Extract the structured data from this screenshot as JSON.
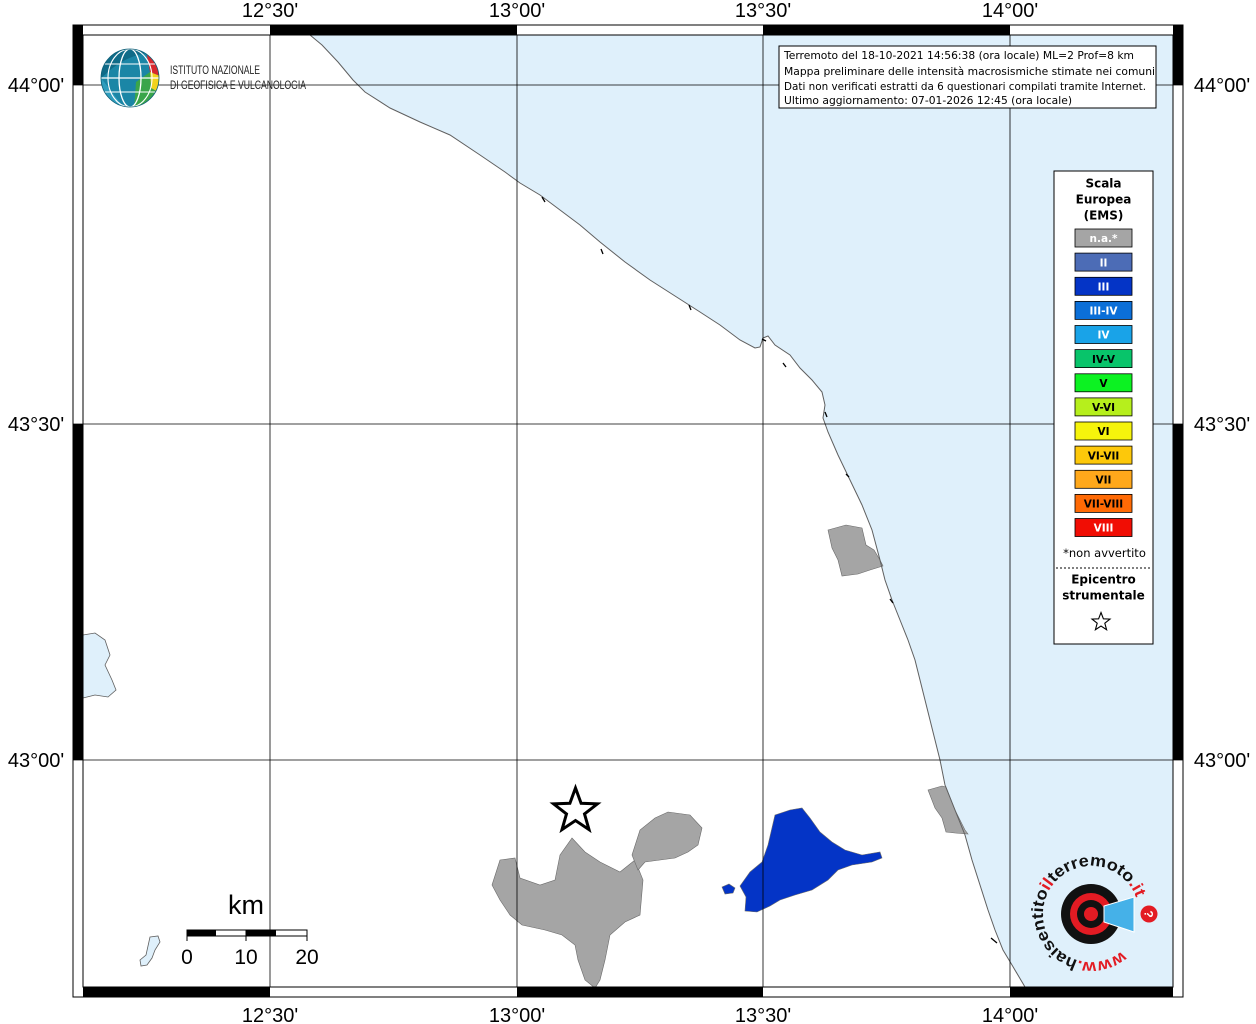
{
  "axes": {
    "lon_labels": [
      "12°30'",
      "13°00'",
      "13°30'",
      "14°00'"
    ],
    "lat_labels": [
      "44°00'",
      "43°30'",
      "43°00'"
    ]
  },
  "institute_logo": {
    "line1": "ISTITUTO NAZIONALE",
    "line2": "DI GEOFISICA E VULCANOLOGIA",
    "icon": "globe-icon"
  },
  "info_box": {
    "lines": [
      "Terremoto del 18-10-2021 14:56:38 (ora locale) ML=2 Prof=8 km",
      "Mappa preliminare delle intensità macrosismiche stimate nei comuni",
      "Dati non verificati estratti da 6 questionari compilati tramite Internet.",
      "Ultimo aggiornamento: 07-01-2026 12:45 (ora locale)"
    ]
  },
  "legend": {
    "title": [
      "Scala",
      "Europea",
      "(EMS)"
    ],
    "entries": [
      {
        "label": "n.a.*",
        "color": "#a5a5a5",
        "text_color": "#ffffff"
      },
      {
        "label": "II",
        "color": "#4c6cb6",
        "text_color": "#ffffff"
      },
      {
        "label": "III",
        "color": "#0434c6",
        "text_color": "#ffffff"
      },
      {
        "label": "III-IV",
        "color": "#0b6fd8",
        "text_color": "#ffffff"
      },
      {
        "label": "IV",
        "color": "#19a3e8",
        "text_color": "#ffffff"
      },
      {
        "label": "IV-V",
        "color": "#08c46a",
        "text_color": "#000000"
      },
      {
        "label": "V",
        "color": "#0cf222",
        "text_color": "#000000"
      },
      {
        "label": "V-VI",
        "color": "#b6ef1c",
        "text_color": "#000000"
      },
      {
        "label": "VI",
        "color": "#f6f40c",
        "text_color": "#000000"
      },
      {
        "label": "VI-VII",
        "color": "#fdc80a",
        "text_color": "#000000"
      },
      {
        "label": "VII",
        "color": "#ffa81b",
        "text_color": "#000000"
      },
      {
        "label": "VII-VIII",
        "color": "#ff6a05",
        "text_color": "#000000"
      },
      {
        "label": "VIII",
        "color": "#f10d04",
        "text_color": "#ffffff"
      }
    ],
    "footnote": "*non avvertito",
    "epicentre_label": [
      "Epicentro",
      "strumentale"
    ],
    "epicentre_icon": "star-outline-icon"
  },
  "map": {
    "colors": {
      "sea": "#dff0fb",
      "land": "#ffffff",
      "coastline": "#5f5f5f",
      "grid": "#000000",
      "frame": "#000000"
    },
    "areas": [
      {
        "legend_index": 0
      },
      {
        "legend_index": 0
      },
      {
        "legend_index": 0
      },
      {
        "legend_index": 0
      },
      {
        "legend_index": 2
      },
      {
        "legend_index": 2
      }
    ],
    "epicentre_icon": "star-outline-icon"
  },
  "scale_bar": {
    "unit": "km",
    "ticks": [
      "0",
      "10",
      "20"
    ]
  },
  "site_logo": {
    "prefix": "www.",
    "part1": "haisentito",
    "part2": "il",
    "part3": "terremoto",
    "suffix": ".it",
    "badge": "?",
    "colors": {
      "dark": "#111111",
      "accent": "#e31b23",
      "wave": "#45b1e8"
    }
  }
}
